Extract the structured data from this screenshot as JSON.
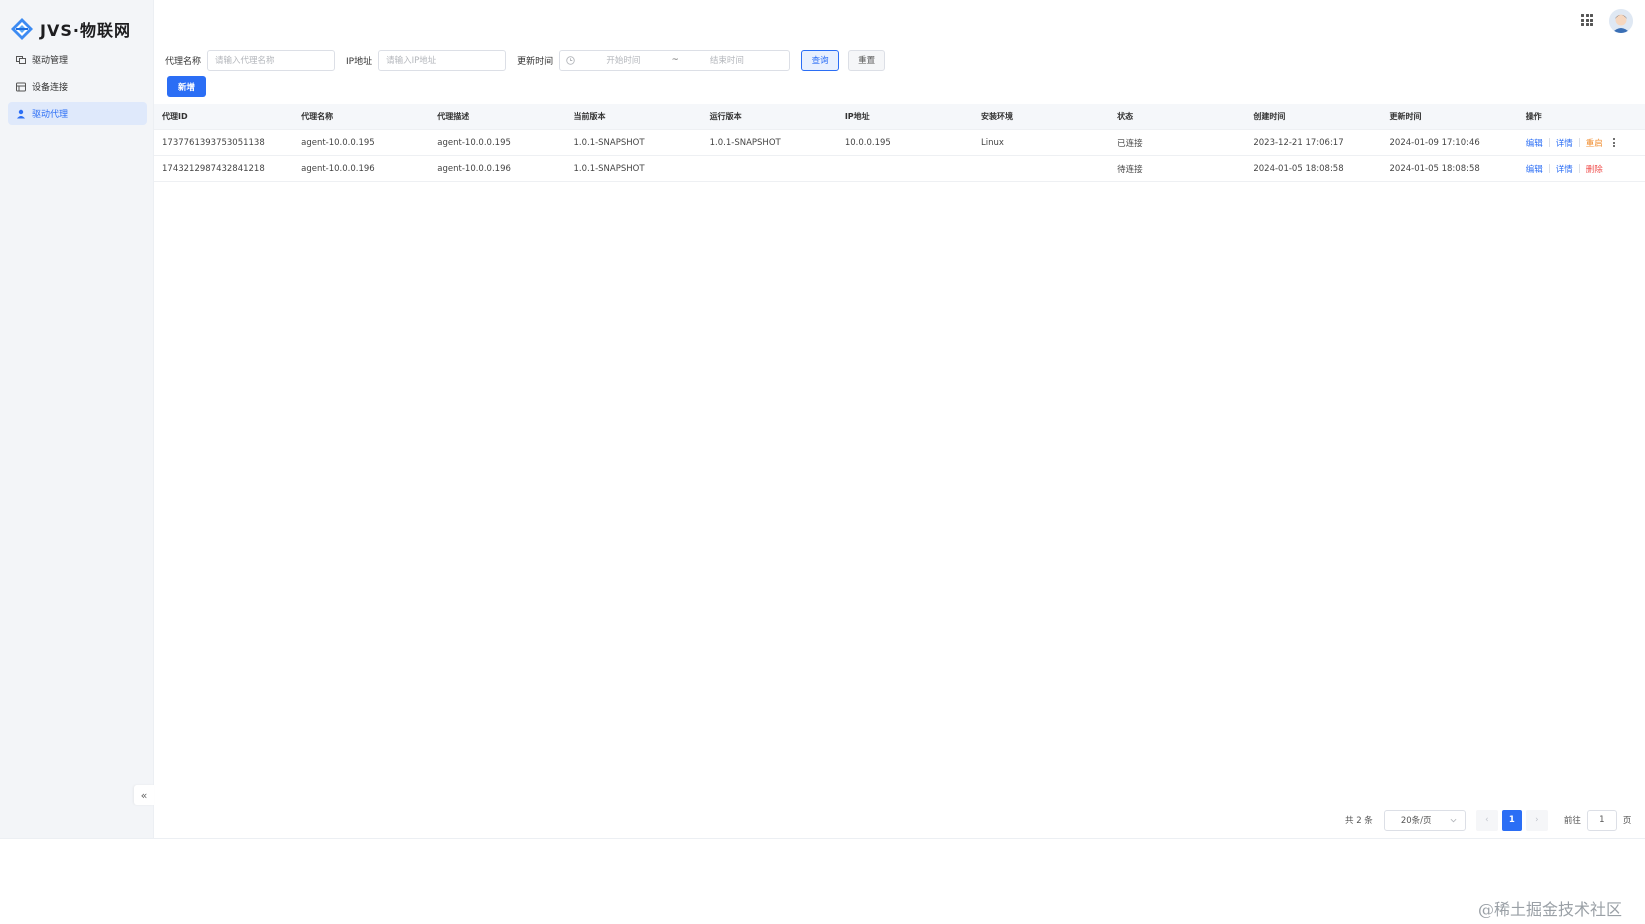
{
  "app": {
    "logo_text": "JVS·物联网"
  },
  "sidebar": {
    "items": [
      {
        "label": "驱动管理",
        "icon": "driver-icon",
        "active": false
      },
      {
        "label": "设备连接",
        "icon": "device-icon",
        "active": false
      },
      {
        "label": "驱动代理",
        "icon": "person-icon",
        "active": true
      }
    ],
    "collapse_label": "«"
  },
  "search": {
    "agent_name_label": "代理名称",
    "agent_name_placeholder": "请输入代理名称",
    "ip_label": "IP地址",
    "ip_placeholder": "请输入IP地址",
    "update_time_label": "更新时间",
    "start_placeholder": "开始时间",
    "range_sep": "~",
    "end_placeholder": "结束时间",
    "query_label": "查询",
    "reset_label": "重置"
  },
  "toolbar": {
    "add_label": "新增"
  },
  "table": {
    "columns": [
      "代理ID",
      "代理名称",
      "代理描述",
      "当前版本",
      "运行版本",
      "IP地址",
      "安装环境",
      "状态",
      "创建时间",
      "更新时间",
      "操作"
    ],
    "rows": [
      {
        "id": "1737761393753051138",
        "name": "agent-10.0.0.195",
        "desc": "agent-10.0.0.195",
        "current_version": "1.0.1-SNAPSHOT",
        "running_version": "1.0.1-SNAPSHOT",
        "ip": "10.0.0.195",
        "env": "Linux",
        "status": "已连接",
        "created": "2023-12-21 17:06:17",
        "updated": "2024-01-09 17:10:46",
        "ops": [
          "编辑",
          "详情",
          "重启"
        ]
      },
      {
        "id": "1743212987432841218",
        "name": "agent-10.0.0.196",
        "desc": "agent-10.0.0.196",
        "current_version": "1.0.1-SNAPSHOT",
        "running_version": "",
        "ip": "",
        "env": "",
        "status": "待连接",
        "created": "2024-01-05 18:08:58",
        "updated": "2024-01-05 18:08:58",
        "ops": [
          "编辑",
          "详情",
          "删除"
        ]
      }
    ]
  },
  "pagination": {
    "total_text": "共 2 条",
    "page_size": "20条/页",
    "prev": "‹",
    "current_page": "1",
    "next": "›",
    "goto_label": "前往",
    "goto_value": "1",
    "page_unit": "页"
  },
  "footer": {
    "watermark": "@稀土掘金技术社区"
  },
  "colors": {
    "primary": "#2b6ef5",
    "warning": "#f08c2d",
    "danger": "#f0504e"
  }
}
